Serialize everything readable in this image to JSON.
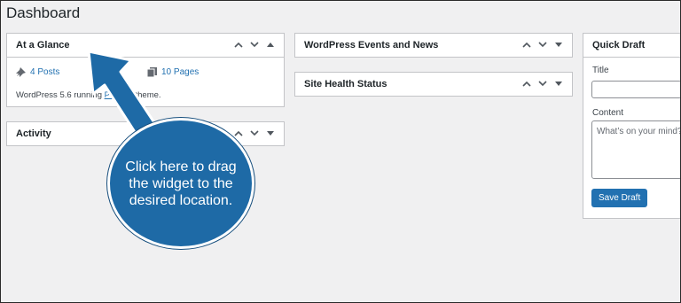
{
  "page": {
    "title": "Dashboard"
  },
  "at_a_glance": {
    "title": "At a Glance",
    "posts": "4 Posts",
    "pages": "10 Pages",
    "info_prefix": "WordPress 5.6 running ",
    "theme_link": "Ponsan",
    "info_suffix": " theme."
  },
  "activity": {
    "title": "Activity"
  },
  "events": {
    "title": "WordPress Events and News"
  },
  "site_health": {
    "title": "Site Health Status"
  },
  "quick_draft": {
    "title": "Quick Draft",
    "title_label": "Title",
    "content_label": "Content",
    "content_placeholder": "What’s on your mind?",
    "save_label": "Save Draft"
  },
  "callout": {
    "text": "Click here to drag the widget to the desired location."
  },
  "colors": {
    "accent": "#2271b1",
    "callout": "#1e6aa6"
  }
}
